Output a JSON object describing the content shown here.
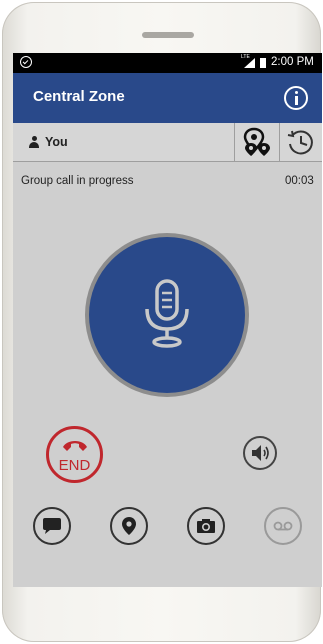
{
  "status_bar": {
    "time": "2:00 PM",
    "network_label": "LTE"
  },
  "app_bar": {
    "title": "Central Zone",
    "info_icon": "info-icon"
  },
  "user_bar": {
    "name": "You",
    "location_icon": "map-pins-icon",
    "history_icon": "history-icon"
  },
  "call": {
    "status_text": "Group call in progress",
    "timer": "00:03"
  },
  "controls": {
    "end_label": "END",
    "talk_icon": "microphone-icon",
    "speaker_icon": "speaker-icon",
    "bottom": [
      "chat-icon",
      "location-icon",
      "camera-icon",
      "voicemail-icon"
    ]
  },
  "colors": {
    "primary": "#29498a",
    "end": "#c0272d",
    "background": "#cfcfcf"
  }
}
